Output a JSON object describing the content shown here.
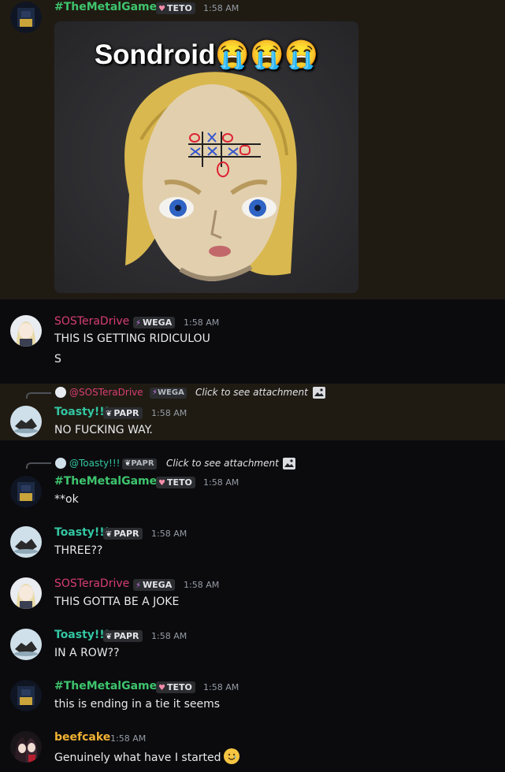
{
  "messages": {
    "m1": {
      "author": "#TheMetalGames",
      "tag": "TETO",
      "time": "1:58 AM",
      "embed_caption": "Sondroid😭😭😭",
      "embed_image": "tic-tac-toe-head-figure"
    },
    "m2": {
      "author": "SOSTeraDrive",
      "tag": "WEGA",
      "time": "1:58 AM",
      "line1": "THIS IS GETTING RIDICULOU",
      "line2": "S"
    },
    "m3": {
      "reply": {
        "author": "@SOSTeraDrive",
        "tag": "WEGA",
        "text": "Click to see attachment"
      },
      "author": "Toasty!!!",
      "tag": "PAPR",
      "time": "1:58 AM",
      "text": "NO FUCKING WAY."
    },
    "m4": {
      "reply": {
        "author": "@Toasty!!!",
        "tag": "PAPR",
        "text": "Click to see attachment"
      },
      "author": "#TheMetalGames",
      "tag": "TETO",
      "time": "1:58 AM",
      "text": "**ok"
    },
    "m5": {
      "author": "Toasty!!!",
      "tag": "PAPR",
      "time": "1:58 AM",
      "text": "THREE??"
    },
    "m6": {
      "author": "SOSTeraDrive",
      "tag": "WEGA",
      "time": "1:58 AM",
      "text": "THIS GOTTA BE A JOKE"
    },
    "m7": {
      "author": "Toasty!!!",
      "tag": "PAPR",
      "time": "1:58 AM",
      "text": "IN A ROW??"
    },
    "m8": {
      "author": "#TheMetalGames",
      "tag": "TETO",
      "time": "1:58 AM",
      "text": "this is ending in a tie it seems"
    },
    "m9": {
      "author": "beefcake",
      "time": "1:58 AM",
      "text": "Genuinely what have I started",
      "emoji": "smiling-face-with-tear-emoji"
    }
  },
  "colors": {
    "background": "#0b0b0e",
    "highlight": "#1f1b13",
    "metal_name": "#3ec46d",
    "sos_name": "#d83d72",
    "toasty_name": "#33c6a2",
    "beefcake_name": "#f0b232"
  }
}
